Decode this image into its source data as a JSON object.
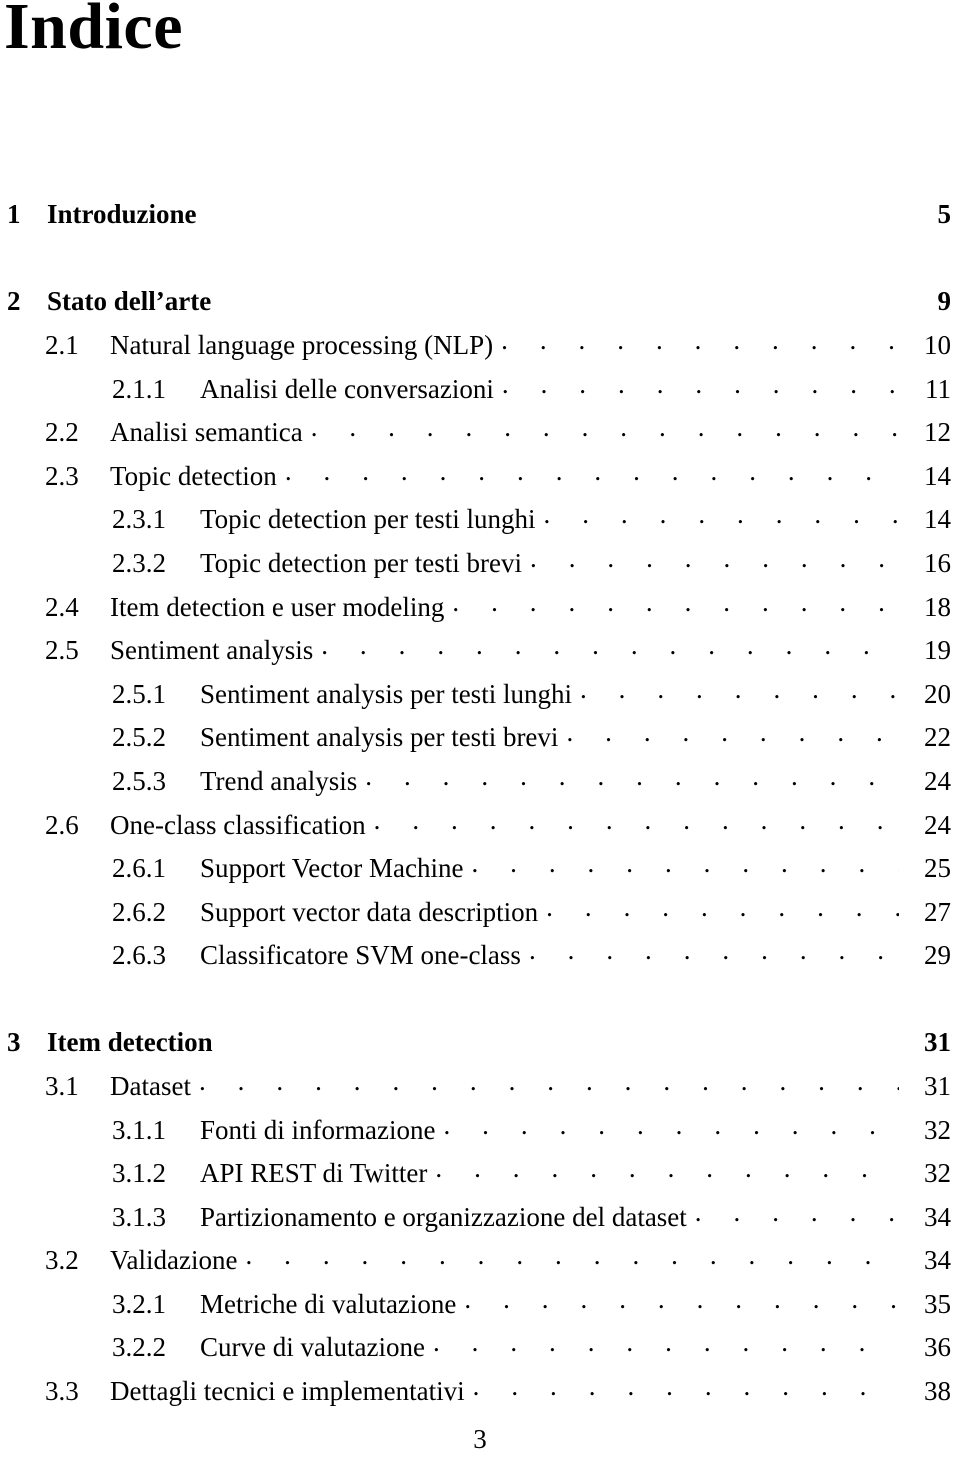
{
  "document": {
    "title": "Indice",
    "folio": "3"
  },
  "toc": {
    "entries": [
      {
        "level": "chapter",
        "number": "1",
        "label": "Introduzione",
        "page": "5",
        "spaced": false
      },
      {
        "level": "chapter",
        "number": "2",
        "label": "Stato dell’arte",
        "page": "9",
        "spaced": true
      },
      {
        "level": "section",
        "number": "2.1",
        "label": "Natural language processing (NLP)",
        "page": "10",
        "spaced": false
      },
      {
        "level": "subsection",
        "number": "2.1.1",
        "label": "Analisi delle conversazioni",
        "page": "11",
        "spaced": false
      },
      {
        "level": "section",
        "number": "2.2",
        "label": "Analisi semantica",
        "page": "12",
        "spaced": false
      },
      {
        "level": "section",
        "number": "2.3",
        "label": "Topic detection",
        "page": "14",
        "spaced": false
      },
      {
        "level": "subsection",
        "number": "2.3.1",
        "label": "Topic detection per testi lunghi",
        "page": "14",
        "spaced": false
      },
      {
        "level": "subsection",
        "number": "2.3.2",
        "label": "Topic detection per testi brevi",
        "page": "16",
        "spaced": false
      },
      {
        "level": "section",
        "number": "2.4",
        "label": "Item detection e user modeling",
        "page": "18",
        "spaced": false
      },
      {
        "level": "section",
        "number": "2.5",
        "label": "Sentiment analysis",
        "page": "19",
        "spaced": false
      },
      {
        "level": "subsection",
        "number": "2.5.1",
        "label": "Sentiment analysis per testi lunghi",
        "page": "20",
        "spaced": false
      },
      {
        "level": "subsection",
        "number": "2.5.2",
        "label": "Sentiment analysis per testi brevi",
        "page": "22",
        "spaced": false
      },
      {
        "level": "subsection",
        "number": "2.5.3",
        "label": "Trend analysis",
        "page": "24",
        "spaced": false
      },
      {
        "level": "section",
        "number": "2.6",
        "label": "One-class classification",
        "page": "24",
        "spaced": false
      },
      {
        "level": "subsection",
        "number": "2.6.1",
        "label": "Support Vector Machine",
        "page": "25",
        "spaced": false
      },
      {
        "level": "subsection",
        "number": "2.6.2",
        "label": "Support vector data description",
        "page": "27",
        "spaced": false
      },
      {
        "level": "subsection",
        "number": "2.6.3",
        "label": "Classificatore SVM one-class",
        "page": "29",
        "spaced": false
      },
      {
        "level": "chapter",
        "number": "3",
        "label": "Item detection",
        "page": "31",
        "spaced": true
      },
      {
        "level": "section",
        "number": "3.1",
        "label": "Dataset",
        "page": "31",
        "spaced": false
      },
      {
        "level": "subsection",
        "number": "3.1.1",
        "label": "Fonti di informazione",
        "page": "32",
        "spaced": false
      },
      {
        "level": "subsection",
        "number": "3.1.2",
        "label": "API REST di Twitter",
        "page": "32",
        "spaced": false
      },
      {
        "level": "subsection",
        "number": "3.1.3",
        "label": "Partizionamento e organizzazione del dataset",
        "page": "34",
        "spaced": false
      },
      {
        "level": "section",
        "number": "3.2",
        "label": "Validazione",
        "page": "34",
        "spaced": false
      },
      {
        "level": "subsection",
        "number": "3.2.1",
        "label": "Metriche di valutazione",
        "page": "35",
        "spaced": false
      },
      {
        "level": "subsection",
        "number": "3.2.2",
        "label": "Curve di valutazione",
        "page": "36",
        "spaced": false
      },
      {
        "level": "section",
        "number": "3.3",
        "label": "Dettagli tecnici e implementativi",
        "page": "38",
        "spaced": false
      }
    ]
  }
}
